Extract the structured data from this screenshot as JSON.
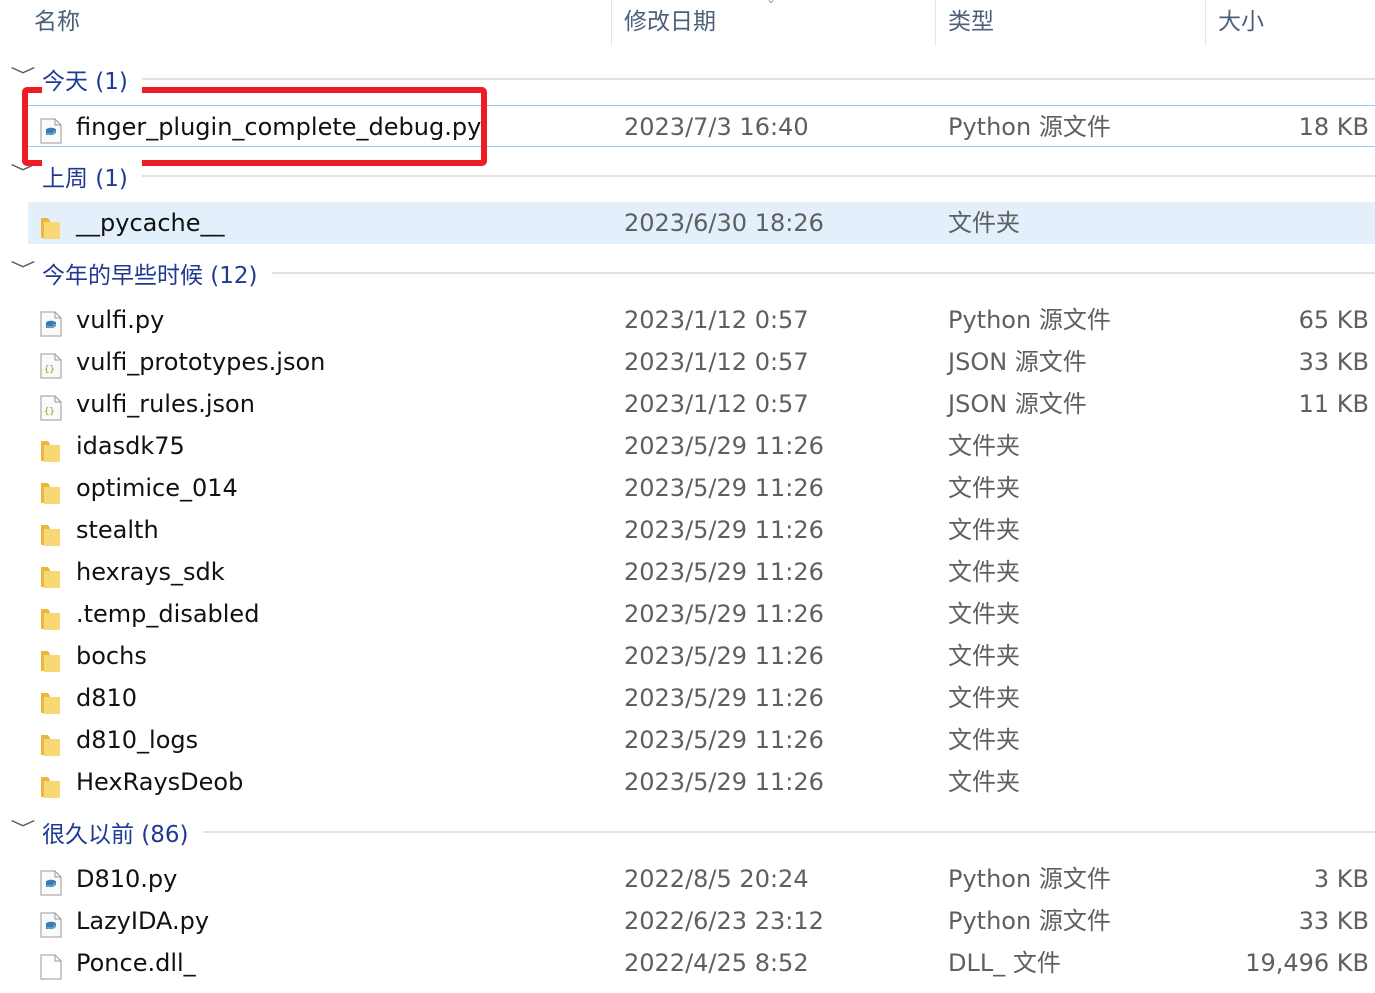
{
  "columns": {
    "name": "名称",
    "date": "修改日期",
    "type": "类型",
    "size": "大小"
  },
  "groups": [
    {
      "label": "今天 (1)",
      "items": [
        {
          "name": "finger_plugin_complete_debug.py",
          "date": "2023/7/3 16:40",
          "type": "Python 源文件",
          "size": "18 KB",
          "icon": "python-file-icon",
          "state": "focused"
        }
      ]
    },
    {
      "label": "上周 (1)",
      "items": [
        {
          "name": "__pycache__",
          "date": "2023/6/30 18:26",
          "type": "文件夹",
          "size": "",
          "icon": "folder-icon",
          "state": "selected"
        }
      ]
    },
    {
      "label": "今年的早些时候 (12)",
      "items": [
        {
          "name": "vulfi.py",
          "date": "2023/1/12 0:57",
          "type": "Python 源文件",
          "size": "65 KB",
          "icon": "python-file-icon"
        },
        {
          "name": "vulfi_prototypes.json",
          "date": "2023/1/12 0:57",
          "type": "JSON 源文件",
          "size": "33 KB",
          "icon": "json-file-icon"
        },
        {
          "name": "vulfi_rules.json",
          "date": "2023/1/12 0:57",
          "type": "JSON 源文件",
          "size": "11 KB",
          "icon": "json-file-icon"
        },
        {
          "name": "idasdk75",
          "date": "2023/5/29 11:26",
          "type": "文件夹",
          "size": "",
          "icon": "folder-icon"
        },
        {
          "name": "optimice_014",
          "date": "2023/5/29 11:26",
          "type": "文件夹",
          "size": "",
          "icon": "folder-icon"
        },
        {
          "name": "stealth",
          "date": "2023/5/29 11:26",
          "type": "文件夹",
          "size": "",
          "icon": "folder-icon"
        },
        {
          "name": "hexrays_sdk",
          "date": "2023/5/29 11:26",
          "type": "文件夹",
          "size": "",
          "icon": "folder-icon"
        },
        {
          "name": ".temp_disabled",
          "date": "2023/5/29 11:26",
          "type": "文件夹",
          "size": "",
          "icon": "folder-icon"
        },
        {
          "name": "bochs",
          "date": "2023/5/29 11:26",
          "type": "文件夹",
          "size": "",
          "icon": "folder-icon"
        },
        {
          "name": "d810",
          "date": "2023/5/29 11:26",
          "type": "文件夹",
          "size": "",
          "icon": "folder-icon"
        },
        {
          "name": "d810_logs",
          "date": "2023/5/29 11:26",
          "type": "文件夹",
          "size": "",
          "icon": "folder-icon"
        },
        {
          "name": "HexRaysDeob",
          "date": "2023/5/29 11:26",
          "type": "文件夹",
          "size": "",
          "icon": "folder-icon"
        }
      ]
    },
    {
      "label": "很久以前 (86)",
      "items": [
        {
          "name": "D810.py",
          "date": "2022/8/5 20:24",
          "type": "Python 源文件",
          "size": "3 KB",
          "icon": "python-file-icon"
        },
        {
          "name": "LazyIDA.py",
          "date": "2022/6/23 23:12",
          "type": "Python 源文件",
          "size": "33 KB",
          "icon": "python-file-icon"
        },
        {
          "name": "Ponce.dll_",
          "date": "2022/4/25 8:52",
          "type": "DLL_ 文件",
          "size": "19,496 KB",
          "icon": "generic-file-icon"
        }
      ]
    }
  ],
  "colors": {
    "highlight": "#ee1c25",
    "group_label": "#1f3a93",
    "selected_bg": "#e3f0fc"
  }
}
